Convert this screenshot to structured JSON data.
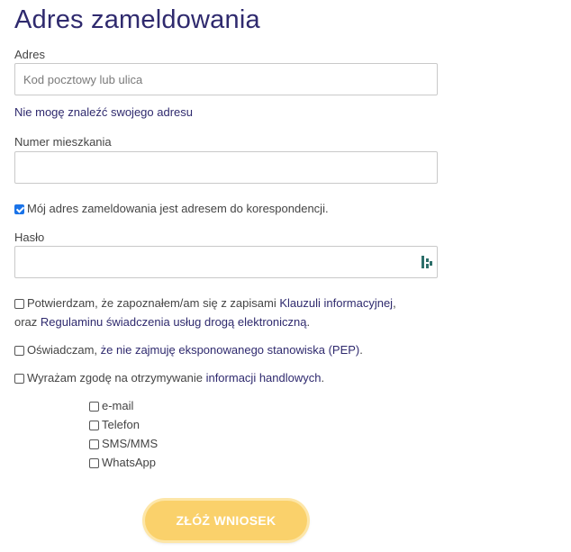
{
  "form": {
    "title": "Adres zameldowania",
    "address": {
      "label": "Adres",
      "placeholder": "Kod pocztowy lub ulica",
      "value": ""
    },
    "cant_find_link": "Nie mogę znaleźć swojego adresu",
    "apartment": {
      "label": "Numer mieszkania",
      "value": ""
    },
    "correspondence_checkbox": {
      "label": "Mój adres zameldowania jest adresem do korespondencji.",
      "checked": true
    },
    "password": {
      "label": "Hasło",
      "value": "",
      "icon": "password-manager-icon"
    },
    "consent_info": {
      "checked": false,
      "text_before": "Potwierdzam, że zapoznałem/am się z zapisami ",
      "link1": "Klauzuli informacyjnej",
      "text_between": ",",
      "line2_before": "oraz ",
      "link2": "Regulaminu świadczenia usług drogą elektroniczną",
      "line2_after": "."
    },
    "pep_statement": {
      "checked": false,
      "text_before": "Oświadczam, ",
      "link": "że nie zajmuję eksponowanego stanowiska (PEP)",
      "text_after": "."
    },
    "marketing_consent": {
      "checked": false,
      "text_before": "Wyrażam zgodę na otrzymywanie ",
      "link": "informacji handlowych",
      "text_after": "."
    },
    "channels": [
      {
        "label": "e-mail",
        "checked": false
      },
      {
        "label": "Telefon",
        "checked": false
      },
      {
        "label": "SMS/MMS",
        "checked": false
      },
      {
        "label": "WhatsApp",
        "checked": false
      }
    ],
    "submit_label": "ZŁÓŻ WNIOSEK"
  },
  "colors": {
    "title": "#2f2a6e",
    "link": "#2f2a6e",
    "submit_bg": "#fad16b",
    "checkbox_checked": "#1a73e8"
  }
}
